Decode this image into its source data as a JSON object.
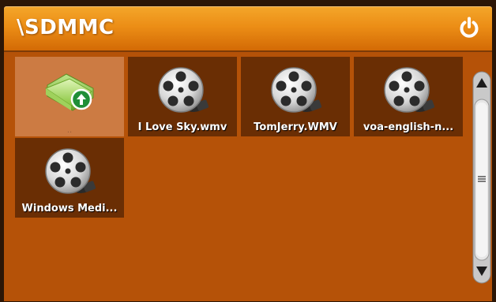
{
  "title_bar": {
    "path": "\\SDMMC",
    "power_icon": "power-icon"
  },
  "files": [
    {
      "label": "..",
      "icon": "folder-up-icon",
      "selected": true
    },
    {
      "label": "I Love Sky.wmv",
      "icon": "film-reel-icon"
    },
    {
      "label": "TomJerry.WMV",
      "icon": "film-reel-icon"
    },
    {
      "label": "voa-english-n...",
      "icon": "film-reel-icon"
    },
    {
      "label": "Windows Medi...",
      "icon": "film-reel-icon"
    }
  ],
  "scrollbar": {
    "up_icon": "arrow-up-icon",
    "down_icon": "arrow-down-icon",
    "grip_icon": "grip-lines-icon"
  },
  "colors": {
    "title_gradient_top": "#f4a62a",
    "title_gradient_bottom": "#d36a05",
    "content_background": "#b55208",
    "tile_background": "#6a2e04",
    "selected_tile": "#cc7b43"
  }
}
